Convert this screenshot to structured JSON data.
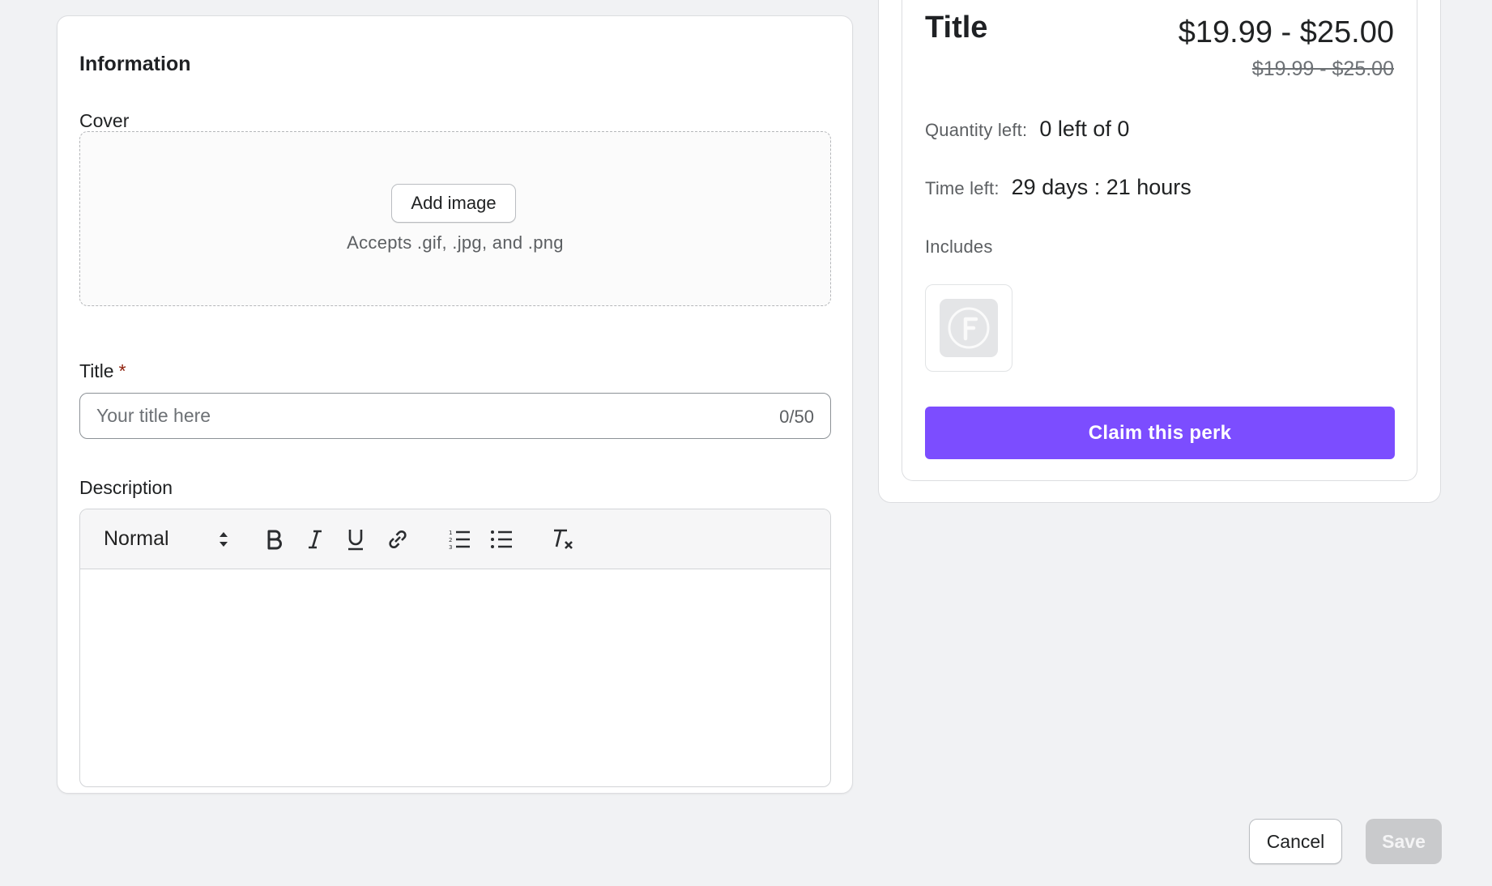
{
  "information": {
    "heading": "Information",
    "cover": {
      "label": "Cover",
      "add_image_label": "Add image",
      "accepts_text": "Accepts .gif, .jpg, and .png"
    },
    "title_field": {
      "label": "Title",
      "required_mark": "*",
      "value": "",
      "placeholder": "Your title here",
      "char_count": "0/50"
    },
    "description": {
      "label": "Description",
      "format_select_value": "Normal",
      "toolbar_icons": [
        "bold-icon",
        "italic-icon",
        "underline-icon",
        "link-icon",
        "ordered-list-icon",
        "bullet-list-icon",
        "clear-format-icon"
      ],
      "content": ""
    }
  },
  "preview": {
    "title": "Title",
    "price": "$19.99 - $25.00",
    "compare_price": "$19.99 - $25.00",
    "quantity_left_label": "Quantity left:",
    "quantity_left_value": "0 left of 0",
    "time_left_label": "Time left:",
    "time_left_value": "29 days : 21 hours",
    "includes_label": "Includes",
    "included_item_icon": "f-logo-icon",
    "claim_button_label": "Claim this perk",
    "claim_button_color": "#7c4dff"
  },
  "footer": {
    "cancel_label": "Cancel",
    "save_label": "Save"
  }
}
